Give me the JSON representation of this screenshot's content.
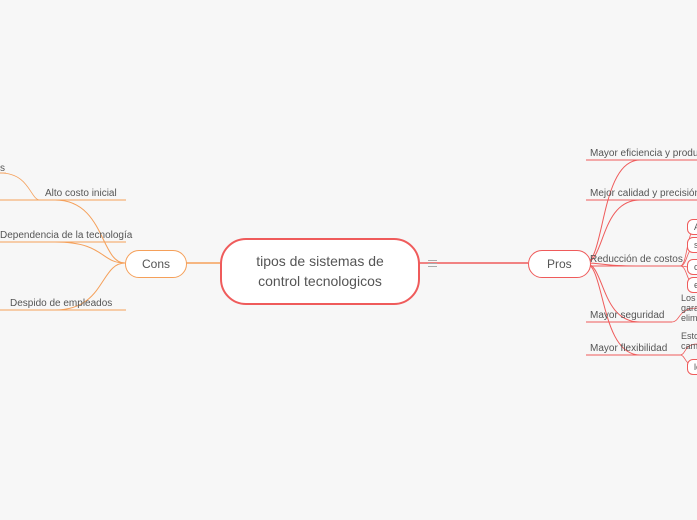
{
  "central": {
    "title": "tipos de sistemas de control tecnologicos"
  },
  "pros": {
    "label": "Pros",
    "items": [
      {
        "label": "Mayor eficiencia y productivida"
      },
      {
        "label": "Mejor calidad y precisión"
      },
      {
        "label": "Reducción de costos",
        "children": [
          "Al a",
          "se p",
          "con",
          "el a"
        ]
      },
      {
        "label": "Mayor seguridad",
        "detail": "Los sis\ngarant\nelimina"
      },
      {
        "label": "Mayor flexibilidad",
        "detail": "Estos s\ncamb",
        "child": "lo que"
      }
    ]
  },
  "cons": {
    "label": "Cons",
    "items": [
      {
        "label": "Alto costo inicial"
      },
      {
        "label": "Dependencia de la tecnología"
      },
      {
        "label": "Despido de empleados"
      }
    ],
    "partial": "s"
  }
}
